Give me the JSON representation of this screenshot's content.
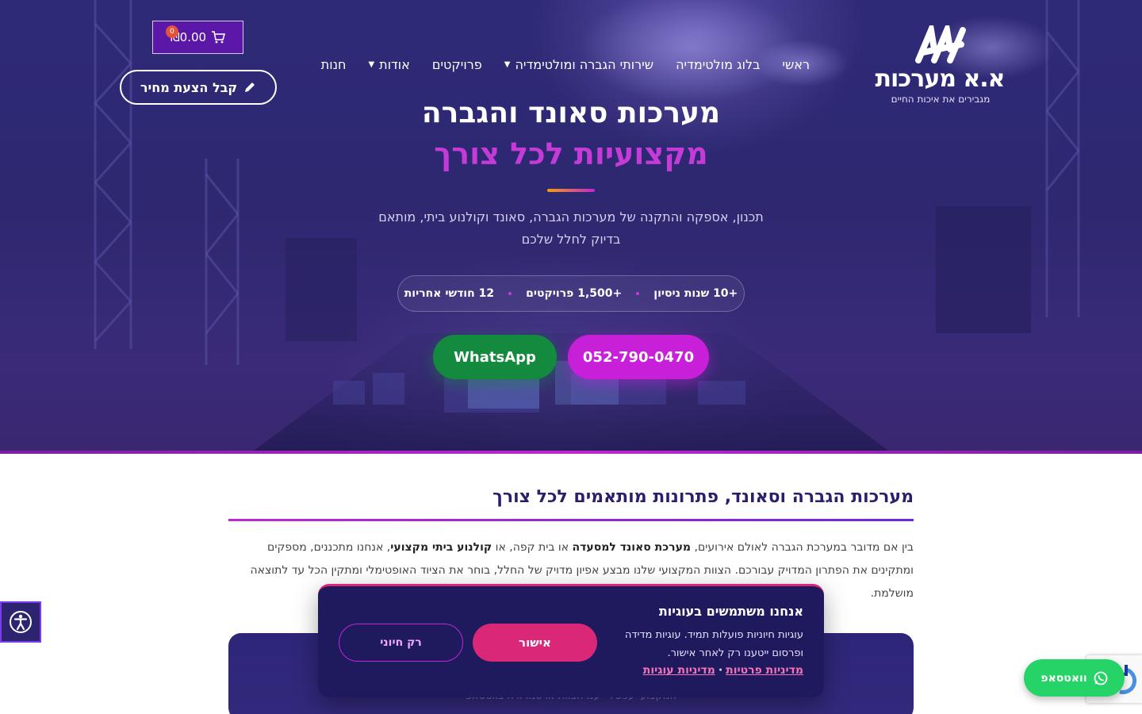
{
  "header": {
    "logo_name": "א.א מערכות",
    "logo_tagline": "מגבירים את איכות החיים",
    "nav": [
      {
        "label": "ראשי",
        "has_dropdown": false
      },
      {
        "label": "בלוג מולטימדיה",
        "has_dropdown": false
      },
      {
        "label": "שירותי הגברה ומולטימדיה",
        "has_dropdown": true
      },
      {
        "label": "פרויקטים",
        "has_dropdown": false
      },
      {
        "label": "אודות",
        "has_dropdown": true
      },
      {
        "label": "חנות",
        "has_dropdown": false
      }
    ],
    "cart_total": "₪0.00",
    "cart_count": "0",
    "quote_button": "קבל הצעת מחיר"
  },
  "hero": {
    "title": "מערכות סאונד והגברה",
    "subtitle": "מקצועיות לכל צורך",
    "description": "תכנון, אספקה והתקנה של מערכות הגברה, סאונד וקולנוע ביתי, מותאם בדיוק לחלל שלכם",
    "stats": [
      "+10 שנות ניסיון",
      "+1,500 פרויקטים",
      "12 חודשי אחריות"
    ],
    "phone_button": "052-790-0470",
    "whatsapp_button": "WhatsApp"
  },
  "content": {
    "section_title": "מערכות הגברה וסאונד, פתרונות מותאמים לכל צורך",
    "body_part1": "בין אם מדובר במערכת הגברה לאולם אירועים, ",
    "body_bold1": "מערכת סאונד למסעדה",
    "body_part2": " או בית קפה, או ",
    "body_bold2": "קולנוע ביתי מקצועי",
    "body_part3": ", אנחנו מתכננים, מספקים ומתקינים את הפתרון המדויק עבורכם. הצוות המקצועי שלנו מבצע אפיון מדויק של החלל, בוחר את הציוד האופטימלי ומתקין הכל עד לתוצאה מושלמת.",
    "card_peek_text": "המקצועי עכשיו - ענו הצוות ארסמו ורח בווטסאפ"
  },
  "cookie": {
    "title": "אנחנו משתמשים בעוגיות",
    "text": "עוגיות חיוניות פועלות תמיד. עוגיות מדידה ופרסום ייטענו רק לאחר אישור.",
    "privacy_link": "מדיניות פרטיות",
    "separator": "·",
    "cookies_link": "מדיניות עוגיות",
    "accept_button": "אישור",
    "essential_button": "רק חיוני"
  },
  "floating": {
    "whatsapp_label": "וואטסאפ"
  },
  "colors": {
    "hero_bg": "#2f2a78",
    "accent_magenta": "#c81fd9",
    "whatsapp_green": "#138a3e",
    "cookie_bg": "#1f1a5e",
    "cookie_accent": "#db2777"
  }
}
